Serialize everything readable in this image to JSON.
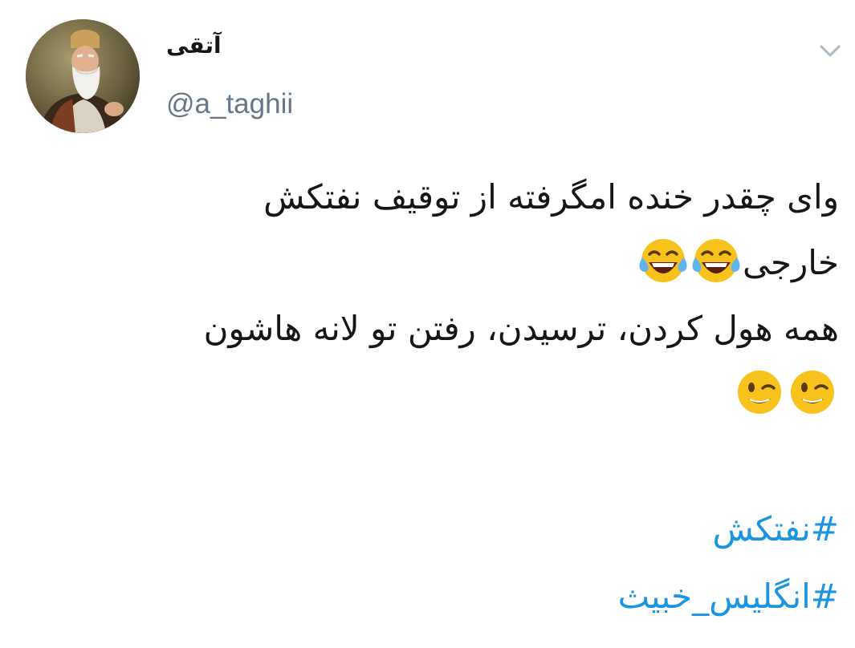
{
  "author": {
    "display_name": "آتقی",
    "handle": "@a_taghii",
    "avatar_icon": "old-man-portrait"
  },
  "menu": {
    "caret_icon": "chevron-down-icon"
  },
  "tweet": {
    "line1": "وای چقدر خنده امگرفته از توقیف نفتکش",
    "line2_text": "خارجی",
    "line2_emoji": "face-with-tears-of-joy",
    "line3": "همه هول کردن، ترسیدن، رفتن تو لانه هاشون",
    "line4_emoji": "winking-face"
  },
  "hashtags": [
    "#نفتکش",
    "#انگلیس_خبیث"
  ],
  "colors": {
    "text": "#14171a",
    "handle": "#657786",
    "link": "#1b95e0",
    "caret": "#aab8c2",
    "emoji_face": "#f7c21b",
    "tear": "#5fb4f0"
  }
}
